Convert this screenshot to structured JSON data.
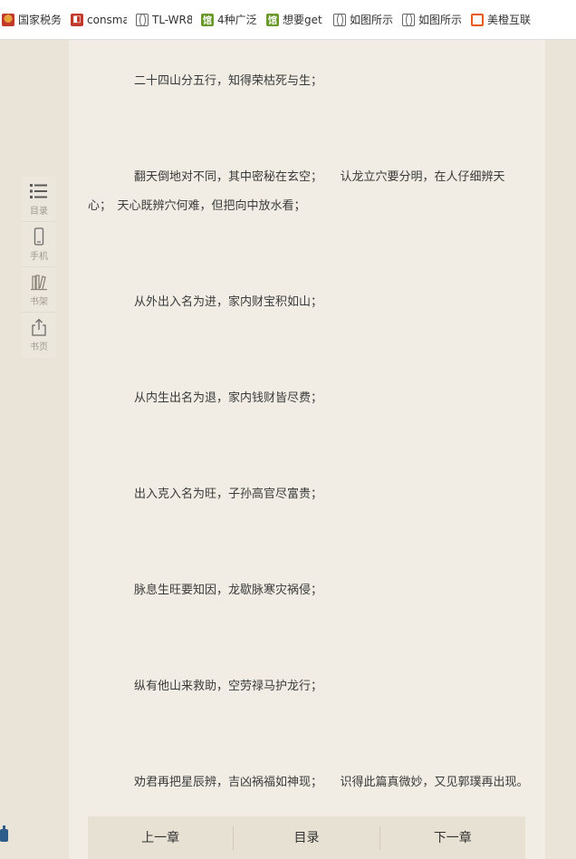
{
  "bookmarks": [
    {
      "icon": "tax-bureau-icon",
      "label": "国家税务"
    },
    {
      "icon": "consmation-icon",
      "label": "consma"
    },
    {
      "icon": "globe-icon",
      "label": "TL-WR8"
    },
    {
      "icon": "guan-icon",
      "label": "4种广泛"
    },
    {
      "icon": "guan-icon",
      "label": "想要get"
    },
    {
      "icon": "globe-icon",
      "label": "如图所示"
    },
    {
      "icon": "globe-icon",
      "label": "如图所示"
    },
    {
      "icon": "orange-icon",
      "label": "美橙互联"
    }
  ],
  "sidebar": {
    "items": [
      {
        "icon": "list-icon",
        "label": "目录"
      },
      {
        "icon": "phone-icon",
        "label": "手机"
      },
      {
        "icon": "books-icon",
        "label": "书架"
      },
      {
        "icon": "share-icon",
        "label": "书页"
      }
    ]
  },
  "content": {
    "lines": [
      "二十四山分五行，知得荣枯死与生；",
      "翻天倒地对不同，其中密秘在玄空；　　认龙立穴要分明，在人仔细辨天",
      "心；　天心既辨穴何难，但把向中放水看；",
      "从外出入名为进，家内财宝积如山；",
      "从内生出名为退，家内钱财皆尽费；",
      "出入克入名为旺，子孙高官尽富贵；",
      "脉息生旺要知因，龙歇脉寒灾祸侵；",
      "纵有他山来救助，空劳禄马护龙行；",
      "劝君再把星辰辨，吉凶祸福如神现；　　识得此篇真微妙，又见郭璞再出现。"
    ]
  },
  "nav": {
    "prev": "上一章",
    "toc": "目录",
    "next": "下一章"
  },
  "colors": {
    "page_bg": "#eae3d8",
    "reader_bg": "#f1ede4",
    "nav_bg": "#e7e1d4",
    "text": "#3a3a3a"
  }
}
